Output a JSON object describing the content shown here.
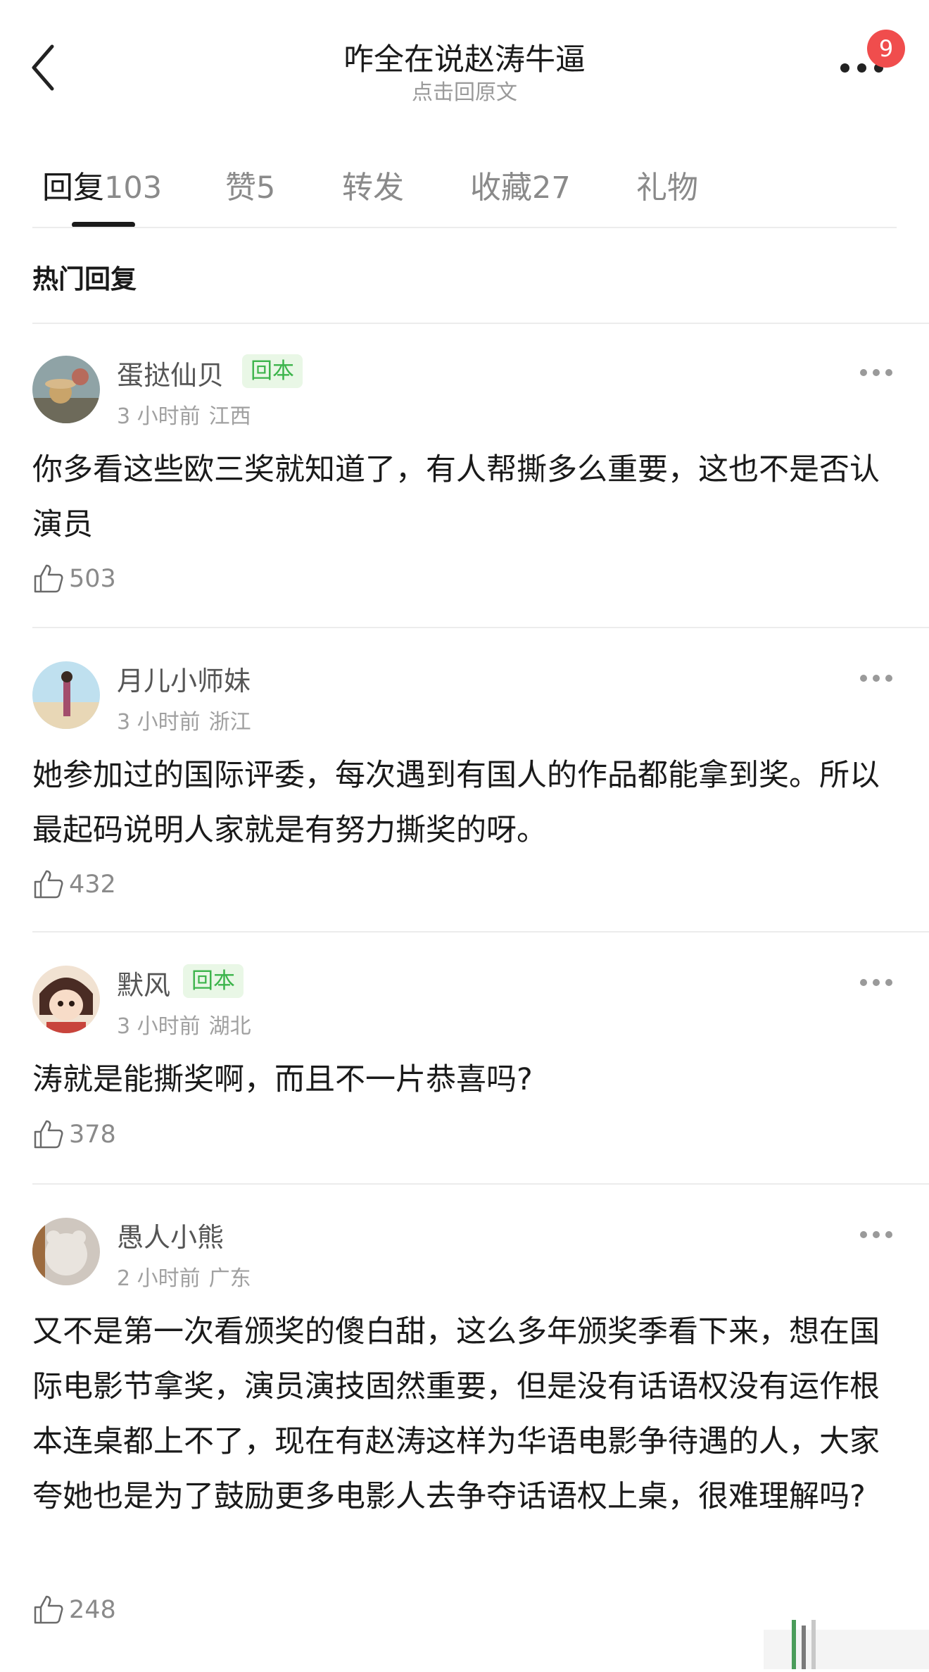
{
  "header": {
    "title": "咋全在说赵涛牛逼",
    "subtitle": "点击回原文",
    "notification_count": "9"
  },
  "tabs": [
    {
      "label": "回复",
      "count": "103"
    },
    {
      "label": "赞",
      "count": "5"
    },
    {
      "label": "转发",
      "count": ""
    },
    {
      "label": "收藏",
      "count": "27"
    },
    {
      "label": "礼物",
      "count": ""
    }
  ],
  "section_title": "热门回复",
  "comments": [
    {
      "username": "蛋挞仙贝",
      "tag": "回本",
      "time": "3 小时前",
      "location": "江西",
      "text": "你多看这些欧三奖就知道了，有人帮撕多么重要，这也不是否认演员",
      "likes": "503"
    },
    {
      "username": "月儿小师妹",
      "tag": "",
      "time": "3 小时前",
      "location": "浙江",
      "text": "她参加过的国际评委，每次遇到有国人的作品都能拿到奖。所以最起码说明人家就是有努力撕奖的呀。",
      "likes": "432"
    },
    {
      "username": "默风",
      "tag": "回本",
      "time": "3 小时前",
      "location": "湖北",
      "text": "涛就是能撕奖啊，而且不一片恭喜吗?",
      "likes": "378"
    },
    {
      "username": "愚人小熊",
      "tag": "",
      "time": "2 小时前",
      "location": "广东",
      "text": "又不是第一次看颁奖的傻白甜，这么多年颁奖季看下来，想在国际电影节拿奖，演员演技固然重要，但是没有话语权没有运作根本连桌都上不了，现在有赵涛这样为华语电影争待遇的人，大家夸她也是为了鼓励更多电影人去争夺话语权上桌，很难理解吗?",
      "likes": "248"
    }
  ],
  "colors": {
    "tag_bg": "#e9f7e6",
    "tag_text": "#3cb44b",
    "badge": "#f04d4d"
  }
}
